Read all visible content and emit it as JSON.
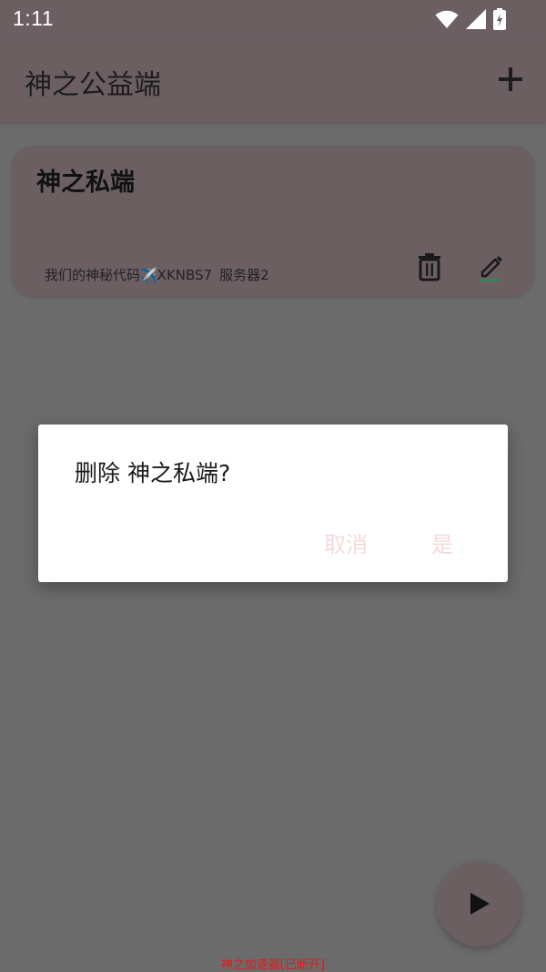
{
  "status_bar": {
    "time": "1:11",
    "icons": [
      "wifi-icon",
      "cellular-signal-icon",
      "battery-charging-icon"
    ]
  },
  "app_bar": {
    "title": "神之公益端",
    "add_icon": "plus-icon"
  },
  "server_card": {
    "title": "神之私端",
    "code_text": "我们的神秘代码✈️XKNBS7",
    "server_label": "服务器2",
    "delete_icon": "trash-icon",
    "edit_icon": "pencil-icon",
    "edit_underline_color": "#1f8f5a"
  },
  "dialog": {
    "message": "删除 神之私端?",
    "cancel_label": "取消",
    "confirm_label": "是",
    "button_color": "#f6d9dc"
  },
  "fab": {
    "icon": "play-icon"
  },
  "footer": {
    "status_text": "神之加速器[已断开]",
    "status_color": "#e01b1b"
  },
  "colors": {
    "surface_dim": "#6b5f62",
    "background_dim": "#6b6b6b"
  }
}
